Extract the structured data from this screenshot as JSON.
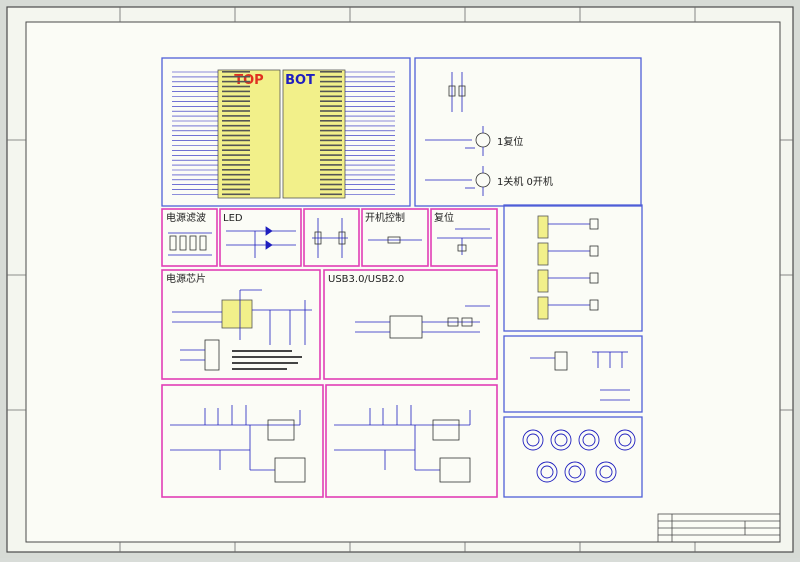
{
  "colors": {
    "border": "#5b5b5b",
    "paper": "#fbfcf6",
    "blue_box": "#4f5fd8",
    "magenta_box": "#e23fb6",
    "wire": "#1f1fbf",
    "red": "#e03020",
    "chip": "#f2f08a"
  },
  "schematic": {
    "main_mcu": {
      "top_label": "TOP",
      "bot_label": "BOT"
    },
    "reset_block": {
      "reset_label": "1复位",
      "power_label": "1关机 0开机"
    },
    "filter_block": {
      "title": "电源滤波"
    },
    "led_block": {
      "title": "LED"
    },
    "power_switch_block": {
      "title": "开机控制"
    },
    "reset_small_block": {
      "title": "复位"
    },
    "power_ic_block": {
      "title": "电源芯片"
    },
    "usb_block": {
      "title": "USB3.0/USB2.0"
    }
  }
}
